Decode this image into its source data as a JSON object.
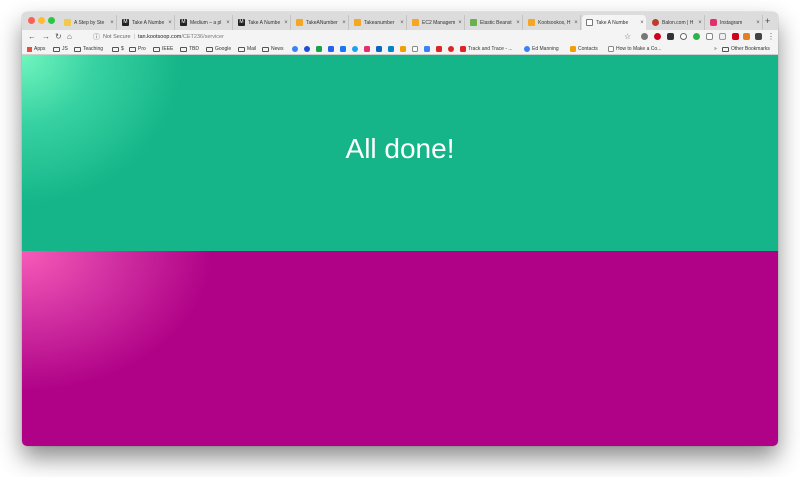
{
  "tabs": [
    {
      "title": "A Step by Ste",
      "icon": "step-icon",
      "color": "#f2c94c"
    },
    {
      "title": "Take A Numbe",
      "icon": "m-icon",
      "color": "#222222"
    },
    {
      "title": "Medium – a pl",
      "icon": "m-icon",
      "color": "#222222"
    },
    {
      "title": "Take A Numbe",
      "icon": "m-icon",
      "color": "#222222"
    },
    {
      "title": "TakeANumber",
      "icon": "aws-icon",
      "color": "#f5a623"
    },
    {
      "title": "Takeanumber",
      "icon": "aws-icon",
      "color": "#f5a623"
    },
    {
      "title": "EC2 Managem",
      "icon": "ec2-icon",
      "color": "#f5a623"
    },
    {
      "title": "Elastic Beanst",
      "icon": "beanstalk-icon",
      "color": "#6ab04c"
    },
    {
      "title": "Kootsookos, H",
      "icon": "keyhole-icon",
      "color": "#f5a623"
    },
    {
      "title": "Take A Numbe",
      "icon": "page-icon",
      "color": "#ffffff"
    },
    {
      "title": "Balon.com | H",
      "icon": "balon-icon",
      "color": "#c0392b"
    },
    {
      "title": "Instagram",
      "icon": "instagram-icon",
      "color": "#e1306c"
    }
  ],
  "toolbar": {
    "not_secure": "Not Secure",
    "separator": "|",
    "host": "tan.kootsoop.com",
    "path": "/CET236/servicer"
  },
  "bookmarks": {
    "items": [
      {
        "label": "Apps",
        "type": "apps"
      },
      {
        "label": "JS",
        "type": "folder"
      },
      {
        "label": "Teaching",
        "type": "folder"
      },
      {
        "label": "$",
        "type": "folder"
      },
      {
        "label": "Pro",
        "type": "folder"
      },
      {
        "label": "IEEE",
        "type": "folder"
      },
      {
        "label": "TBD",
        "type": "folder"
      },
      {
        "label": "Google",
        "type": "folder"
      },
      {
        "label": "Mail",
        "type": "folder"
      },
      {
        "label": "News",
        "type": "folder"
      },
      {
        "label": "Track and Trace - ...",
        "type": "link"
      },
      {
        "label": "Ed Manning",
        "type": "link"
      },
      {
        "label": "Contacts",
        "type": "link"
      },
      {
        "label": "How to Make a Co...",
        "type": "link"
      }
    ],
    "overflow": "»",
    "other": "Other Bookmarks"
  },
  "page": {
    "status_text": "All done!",
    "top_color": "#15b589",
    "bottom_color": "#b00287"
  }
}
